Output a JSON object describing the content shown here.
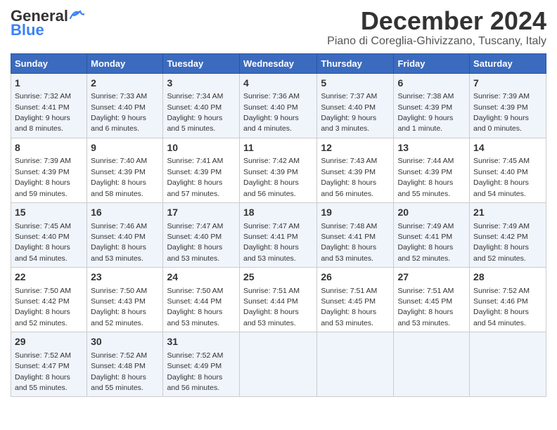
{
  "header": {
    "logo_general": "General",
    "logo_blue": "Blue",
    "title": "December 2024",
    "subtitle": "Piano di Coreglia-Ghivizzano, Tuscany, Italy"
  },
  "days_of_week": [
    "Sunday",
    "Monday",
    "Tuesday",
    "Wednesday",
    "Thursday",
    "Friday",
    "Saturday"
  ],
  "weeks": [
    [
      {
        "day": 1,
        "info": "Sunrise: 7:32 AM\nSunset: 4:41 PM\nDaylight: 9 hours\nand 8 minutes."
      },
      {
        "day": 2,
        "info": "Sunrise: 7:33 AM\nSunset: 4:40 PM\nDaylight: 9 hours\nand 6 minutes."
      },
      {
        "day": 3,
        "info": "Sunrise: 7:34 AM\nSunset: 4:40 PM\nDaylight: 9 hours\nand 5 minutes."
      },
      {
        "day": 4,
        "info": "Sunrise: 7:36 AM\nSunset: 4:40 PM\nDaylight: 9 hours\nand 4 minutes."
      },
      {
        "day": 5,
        "info": "Sunrise: 7:37 AM\nSunset: 4:40 PM\nDaylight: 9 hours\nand 3 minutes."
      },
      {
        "day": 6,
        "info": "Sunrise: 7:38 AM\nSunset: 4:39 PM\nDaylight: 9 hours\nand 1 minute."
      },
      {
        "day": 7,
        "info": "Sunrise: 7:39 AM\nSunset: 4:39 PM\nDaylight: 9 hours\nand 0 minutes."
      }
    ],
    [
      {
        "day": 8,
        "info": "Sunrise: 7:39 AM\nSunset: 4:39 PM\nDaylight: 8 hours\nand 59 minutes."
      },
      {
        "day": 9,
        "info": "Sunrise: 7:40 AM\nSunset: 4:39 PM\nDaylight: 8 hours\nand 58 minutes."
      },
      {
        "day": 10,
        "info": "Sunrise: 7:41 AM\nSunset: 4:39 PM\nDaylight: 8 hours\nand 57 minutes."
      },
      {
        "day": 11,
        "info": "Sunrise: 7:42 AM\nSunset: 4:39 PM\nDaylight: 8 hours\nand 56 minutes."
      },
      {
        "day": 12,
        "info": "Sunrise: 7:43 AM\nSunset: 4:39 PM\nDaylight: 8 hours\nand 56 minutes."
      },
      {
        "day": 13,
        "info": "Sunrise: 7:44 AM\nSunset: 4:39 PM\nDaylight: 8 hours\nand 55 minutes."
      },
      {
        "day": 14,
        "info": "Sunrise: 7:45 AM\nSunset: 4:40 PM\nDaylight: 8 hours\nand 54 minutes."
      }
    ],
    [
      {
        "day": 15,
        "info": "Sunrise: 7:45 AM\nSunset: 4:40 PM\nDaylight: 8 hours\nand 54 minutes."
      },
      {
        "day": 16,
        "info": "Sunrise: 7:46 AM\nSunset: 4:40 PM\nDaylight: 8 hours\nand 53 minutes."
      },
      {
        "day": 17,
        "info": "Sunrise: 7:47 AM\nSunset: 4:40 PM\nDaylight: 8 hours\nand 53 minutes."
      },
      {
        "day": 18,
        "info": "Sunrise: 7:47 AM\nSunset: 4:41 PM\nDaylight: 8 hours\nand 53 minutes."
      },
      {
        "day": 19,
        "info": "Sunrise: 7:48 AM\nSunset: 4:41 PM\nDaylight: 8 hours\nand 53 minutes."
      },
      {
        "day": 20,
        "info": "Sunrise: 7:49 AM\nSunset: 4:41 PM\nDaylight: 8 hours\nand 52 minutes."
      },
      {
        "day": 21,
        "info": "Sunrise: 7:49 AM\nSunset: 4:42 PM\nDaylight: 8 hours\nand 52 minutes."
      }
    ],
    [
      {
        "day": 22,
        "info": "Sunrise: 7:50 AM\nSunset: 4:42 PM\nDaylight: 8 hours\nand 52 minutes."
      },
      {
        "day": 23,
        "info": "Sunrise: 7:50 AM\nSunset: 4:43 PM\nDaylight: 8 hours\nand 52 minutes."
      },
      {
        "day": 24,
        "info": "Sunrise: 7:50 AM\nSunset: 4:44 PM\nDaylight: 8 hours\nand 53 minutes."
      },
      {
        "day": 25,
        "info": "Sunrise: 7:51 AM\nSunset: 4:44 PM\nDaylight: 8 hours\nand 53 minutes."
      },
      {
        "day": 26,
        "info": "Sunrise: 7:51 AM\nSunset: 4:45 PM\nDaylight: 8 hours\nand 53 minutes."
      },
      {
        "day": 27,
        "info": "Sunrise: 7:51 AM\nSunset: 4:45 PM\nDaylight: 8 hours\nand 53 minutes."
      },
      {
        "day": 28,
        "info": "Sunrise: 7:52 AM\nSunset: 4:46 PM\nDaylight: 8 hours\nand 54 minutes."
      }
    ],
    [
      {
        "day": 29,
        "info": "Sunrise: 7:52 AM\nSunset: 4:47 PM\nDaylight: 8 hours\nand 55 minutes."
      },
      {
        "day": 30,
        "info": "Sunrise: 7:52 AM\nSunset: 4:48 PM\nDaylight: 8 hours\nand 55 minutes."
      },
      {
        "day": 31,
        "info": "Sunrise: 7:52 AM\nSunset: 4:49 PM\nDaylight: 8 hours\nand 56 minutes."
      },
      null,
      null,
      null,
      null
    ]
  ]
}
